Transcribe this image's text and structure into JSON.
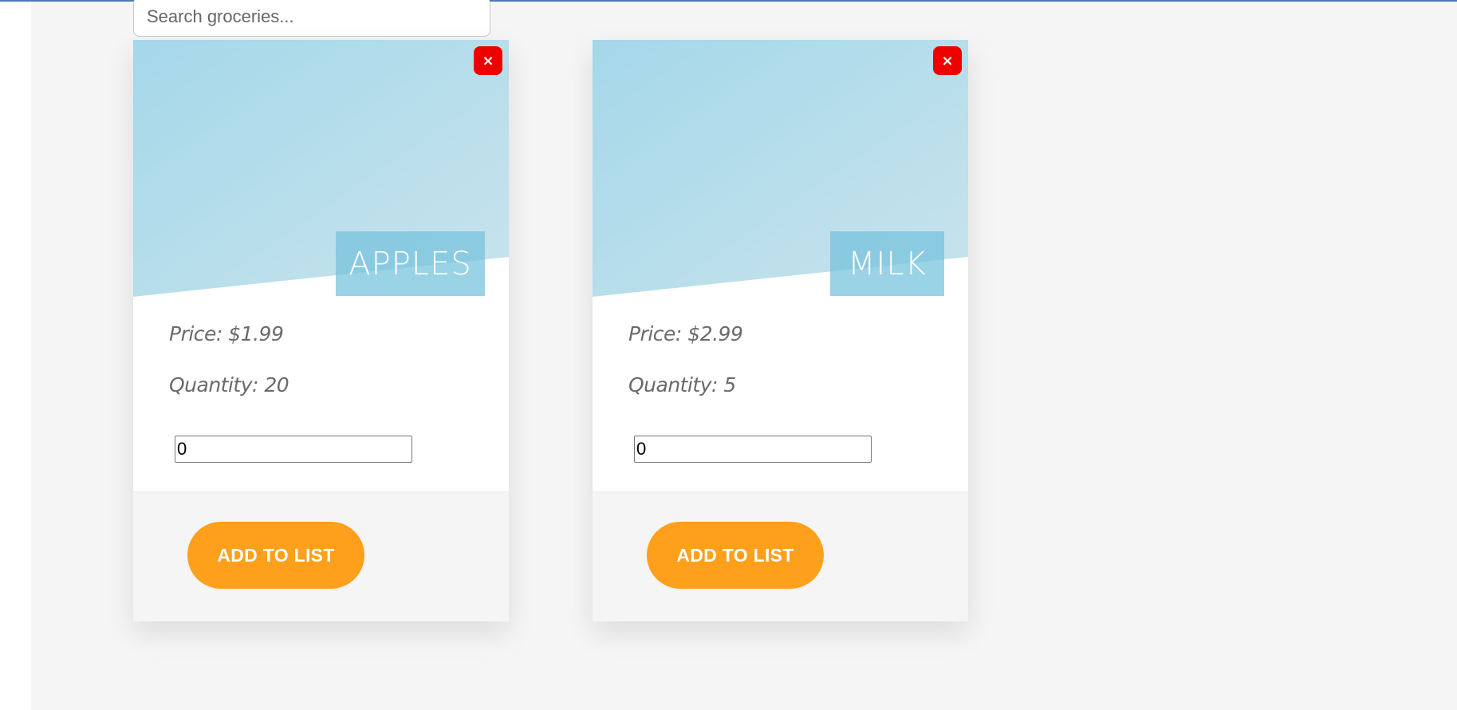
{
  "search": {
    "placeholder": "Search groceries...",
    "value": ""
  },
  "colors": {
    "hero_gradient_start": "#a5d8ea",
    "hero_gradient_end": "#c8e3ec",
    "close_button": "#ee0000",
    "add_button": "#ffa01c",
    "page_background": "#f5f5f5"
  },
  "cards": [
    {
      "name": "APPLES",
      "price": "Price: $1.99",
      "quantity": "Quantity: 20",
      "amount": "0",
      "close_label": "×",
      "add_label": "ADD TO LIST",
      "close_icon": "close-icon"
    },
    {
      "name": "MILK",
      "price": "Price: $2.99",
      "quantity": "Quantity: 5",
      "amount": "0",
      "close_label": "×",
      "add_label": "ADD TO LIST",
      "close_icon": "close-icon"
    }
  ]
}
